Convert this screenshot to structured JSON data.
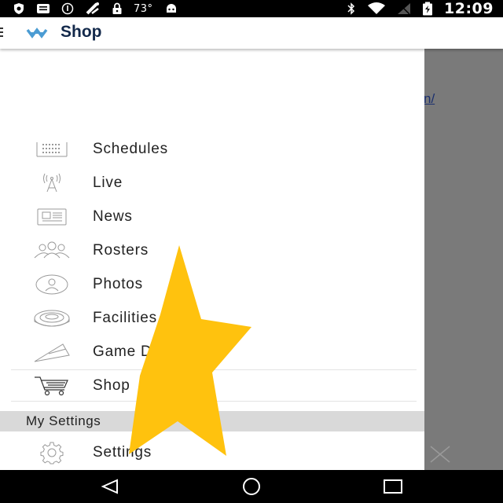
{
  "status_bar": {
    "temperature": "73°",
    "time": "12:09",
    "icons": [
      "shield-icon",
      "message-icon",
      "info-circle-icon",
      "fantasy-football-icon",
      "lock-icon",
      "android-icon",
      "bluetooth-icon",
      "wifi-icon",
      "signal-icon",
      "battery-icon"
    ]
  },
  "app_bar": {
    "title": "Shop",
    "menu_icon": "menu-icon",
    "logo_icon": "unc-logo-icon"
  },
  "backdrop": {
    "link_fragment": "n/"
  },
  "drawer": {
    "items": [
      {
        "label": "Schedules",
        "icon": "calendar-icon"
      },
      {
        "label": "Live",
        "icon": "broadcast-tower-icon"
      },
      {
        "label": "News",
        "icon": "newspaper-icon"
      },
      {
        "label": "Rosters",
        "icon": "team-icon"
      },
      {
        "label": "Photos",
        "icon": "photo-person-icon"
      },
      {
        "label": "Facilities",
        "icon": "stadium-icon"
      },
      {
        "label": "Game Day",
        "icon": "flag-pennant-icon"
      },
      {
        "label": "Shop",
        "icon": "shopping-cart-icon"
      }
    ],
    "section_header": "My Settings",
    "settings_item": {
      "label": "Settings",
      "icon": "gear-icon"
    }
  },
  "colors": {
    "accent_navy": "#13294b",
    "carolina_blue": "#4b9cd3",
    "star_yellow": "#FFC20E",
    "backdrop_gray": "#7a7a7a"
  },
  "nav_bar": {
    "buttons": [
      "back-triangle-icon",
      "home-circle-icon",
      "recents-square-icon"
    ]
  }
}
